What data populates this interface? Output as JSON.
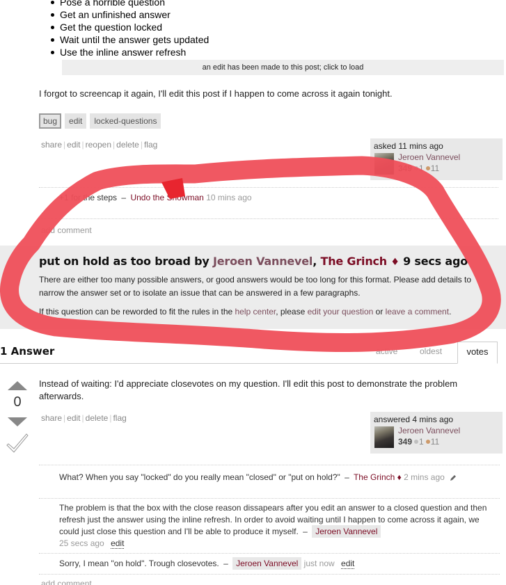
{
  "question": {
    "steps": [
      "Pose a horrible question",
      "Get an unfinished answer",
      "Get the question locked",
      "Wait until the answer gets updated",
      "Use the inline answer refresh"
    ],
    "edit_notice": "an edit has been made to this post; click to load",
    "paragraph": "I forgot to screencap it again, I'll edit this post if I happen to come across it again tonight.",
    "tags": [
      "bug",
      "edit",
      "locked-questions"
    ],
    "menu": [
      "share",
      "edit",
      "reopen",
      "delete",
      "flag"
    ],
    "owner": {
      "action": "asked 11 mins ago",
      "name": "Jeroen Vannevel",
      "reputation": "349",
      "silver": "1",
      "bronze": "11"
    },
    "comments": [
      {
        "text": "+1 for the steps",
        "user": "Undo the Snowman",
        "time": "10 mins ago"
      }
    ],
    "add_comment": "add comment"
  },
  "hold_notice": {
    "prefix": "put on hold as too broad by ",
    "user1": "Jeroen Vannevel",
    "comma": ", ",
    "user2": "The Grinch",
    "diamond": "♦",
    "time": " 9 secs ago",
    "description": "There are either too many possible answers, or good answers would be too long for this format. Please add details to narrow the answer set or to isolate an issue that can be answered in a few paragraphs.",
    "foot_1": "If this question can be reworded to fit the rules in the ",
    "help_center": "help center",
    "foot_2": ", please ",
    "edit_question": "edit your question",
    "foot_3": " or ",
    "leave_comment": "leave a comment",
    "foot_4": "."
  },
  "answers": {
    "header": "1 Answer",
    "tabs": [
      "active",
      "oldest",
      "votes"
    ],
    "selected_tab": "votes"
  },
  "answer": {
    "votes": "0",
    "text": "Instead of waiting: I'd appreciate closevotes on my question. I'll edit this post to demonstrate the problem afterwards.",
    "menu": [
      "share",
      "edit",
      "delete",
      "flag"
    ],
    "owner": {
      "action": "answered 4 mins ago",
      "name": "Jeroen Vannevel",
      "reputation": "349",
      "silver": "1",
      "bronze": "11"
    },
    "comments": [
      {
        "text": "What? When you say \"locked\" do you really mean \"closed\" or \"put on hold?\"",
        "user": "The Grinch",
        "diamond": "♦",
        "time": "2 mins ago"
      },
      {
        "text": "The problem is that the box with the close reason dissapears after you edit an answer to a closed question and then refresh just the answer using the inline refresh. In order to avoid waiting until I happen to come across it again, we could just close this question and I'll be able to produce it myself.",
        "user": "Jeroen Vannevel",
        "time": "25 secs ago",
        "edit": "edit"
      },
      {
        "text": "Sorry, I mean \"on hold\". Trough closevotes.",
        "user": "Jeroen Vannevel",
        "time": "just now",
        "edit": "edit"
      }
    ],
    "add_comment": "add comment"
  },
  "colors": {
    "annotation_red": "#ef4f5a",
    "user_link": "#7b4e5d",
    "moderator_link": "#7b0c24",
    "hold_background": "#ececec",
    "silver_badge": "#c0c0c0",
    "bronze_badge": "#cd9a6a"
  },
  "dash": "–"
}
